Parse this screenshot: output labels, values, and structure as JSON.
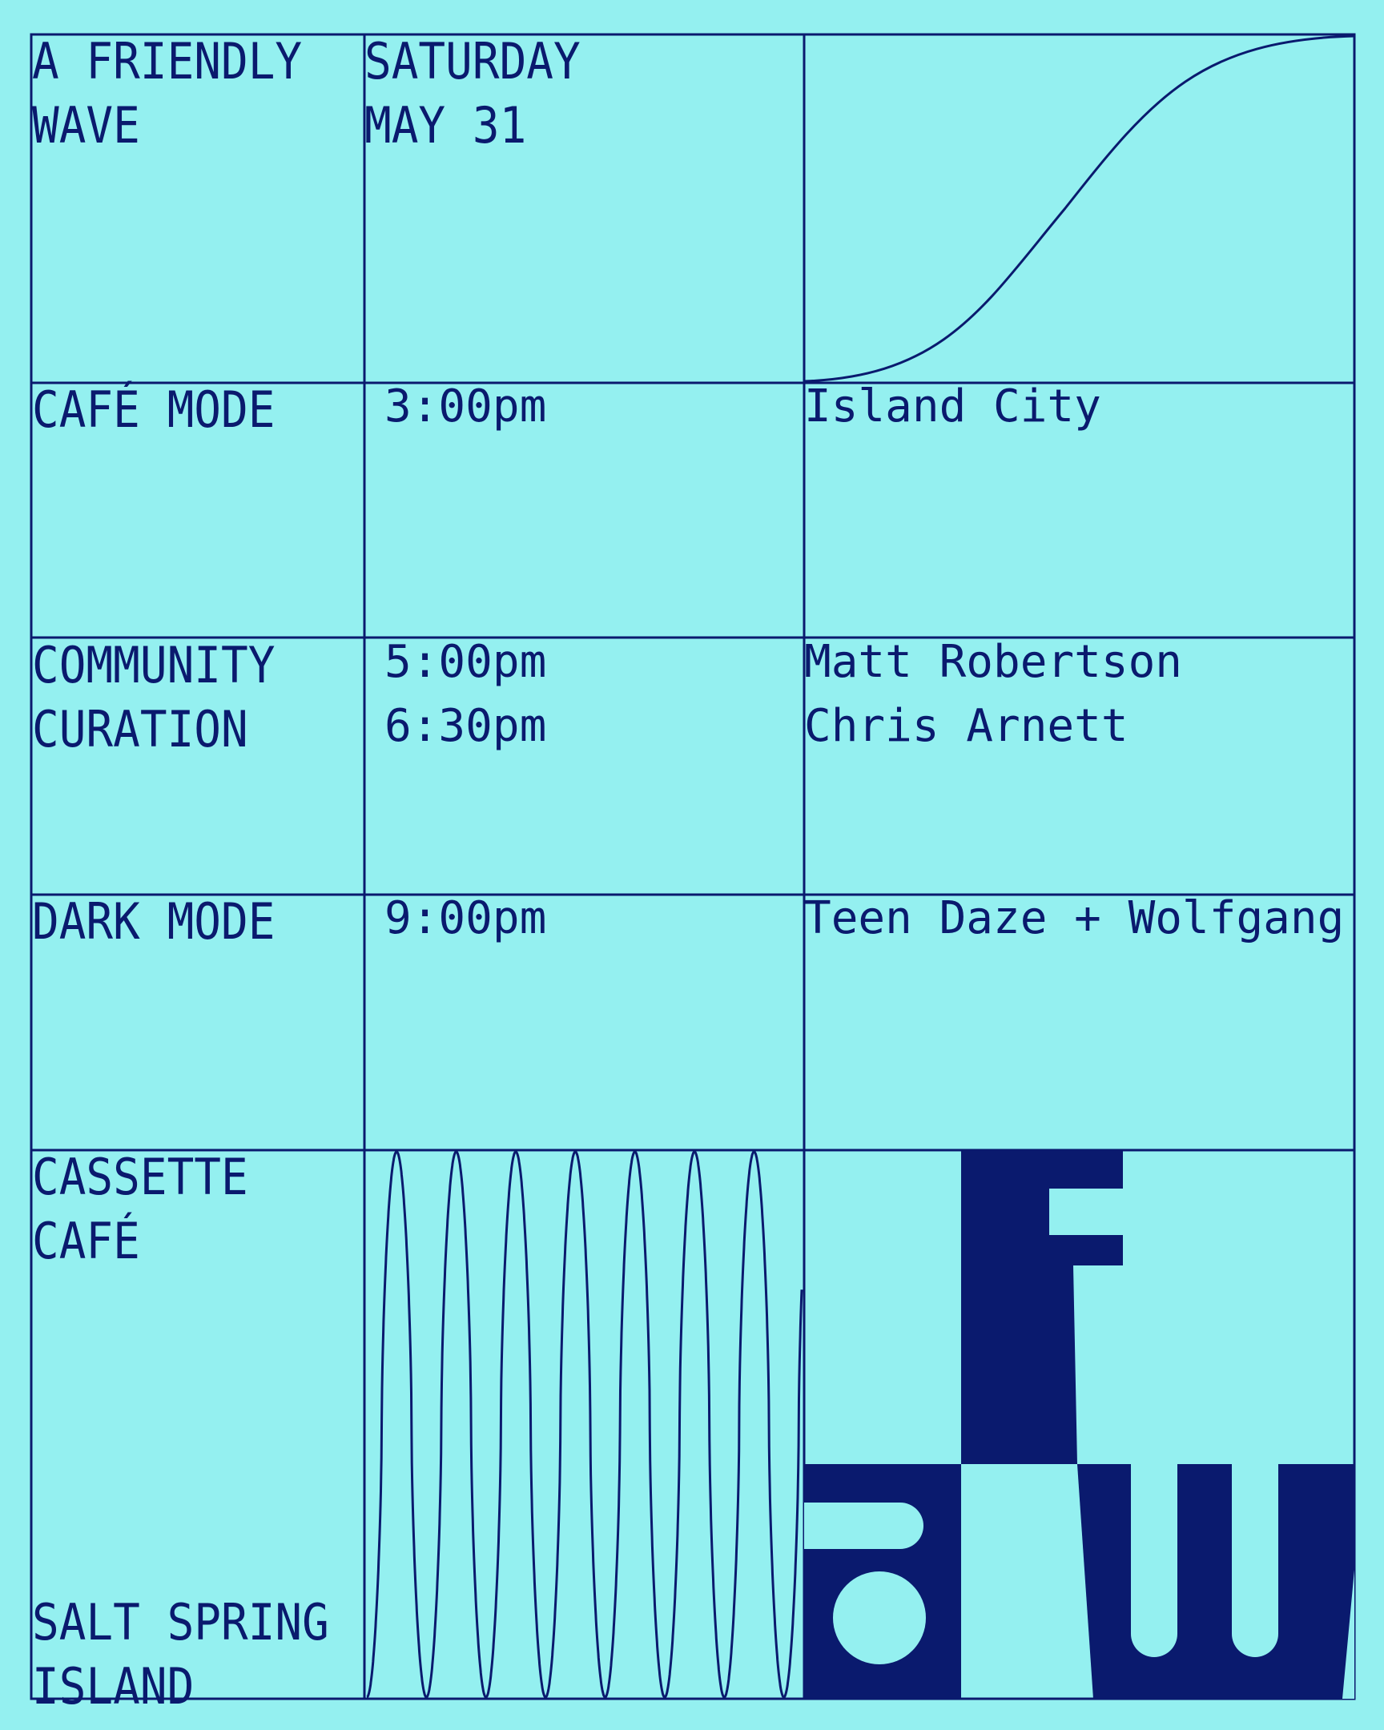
{
  "header": {
    "event_title_line1": "A FRIENDLY",
    "event_title_line2": "WAVE",
    "day": "SATURDAY",
    "date": "MAY 31"
  },
  "schedule": [
    {
      "section": [
        "CAFÉ MODE"
      ],
      "times": [
        "3:00pm"
      ],
      "acts": [
        "Island City"
      ]
    },
    {
      "section": [
        "COMMUNITY",
        "CURATION"
      ],
      "times": [
        "5:00pm",
        "6:30pm"
      ],
      "acts": [
        "Matt Robertson",
        "Chris Arnett"
      ]
    },
    {
      "section": [
        "DARK MODE"
      ],
      "times": [
        "9:00pm"
      ],
      "acts": [
        "Teen Daze + Wolfgang"
      ]
    }
  ],
  "footer": {
    "venue_line1": "CASSETTE",
    "venue_line2": "CAFÉ",
    "location_line1": "SALT SPRING",
    "location_line2": "ISLAND"
  },
  "colors": {
    "background": "#94F0F0",
    "ink": "#0A1A6E"
  },
  "icons": {
    "s_curve": "wave-s-curve-icon",
    "oscillation": "sine-oscillation-icon",
    "logo": "afw-logo-icon"
  }
}
